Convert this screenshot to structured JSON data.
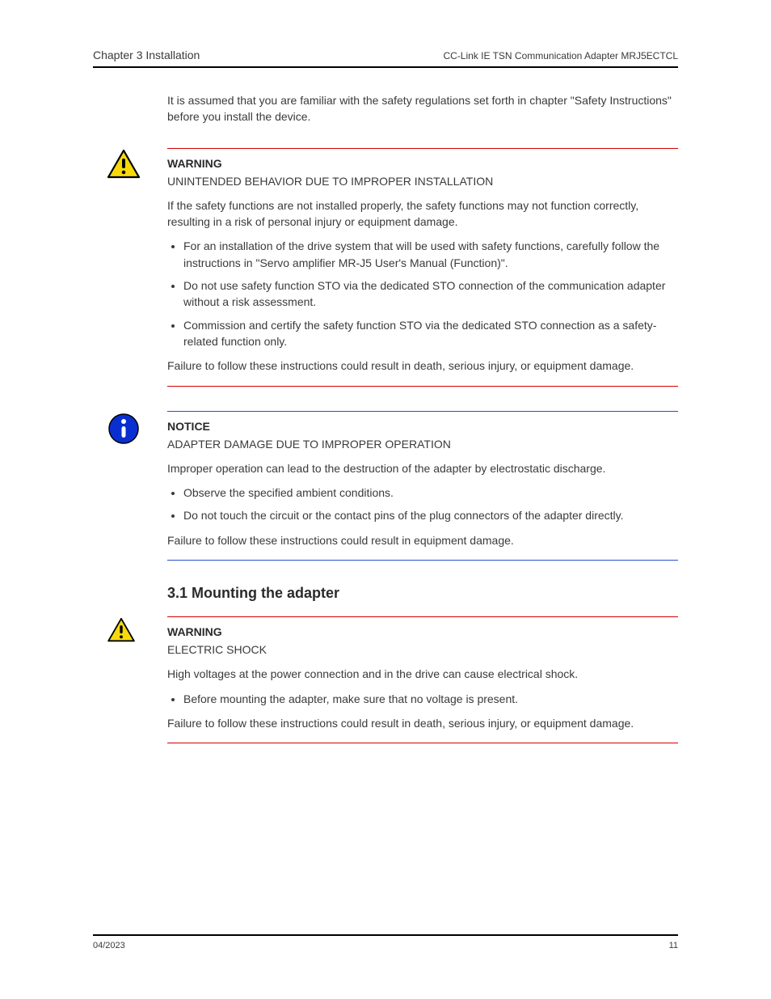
{
  "header": {
    "chapter": "Chapter 3 Installation",
    "doc": "CC-Link IE TSN Communication Adapter MRJ5ECTCL"
  },
  "intro": "It is assumed that you are familiar with the safety regulations set forth in chapter \"Safety Instructions\" before you install the device.",
  "block1": {
    "title": "WARNING",
    "p1": "UNINTENDED BEHAVIOR DUE TO IMPROPER INSTALLATION",
    "p2": "If the safety functions are not installed properly, the safety functions may not function correctly, resulting in a risk of personal injury or equipment damage.",
    "bullets": [
      "For an installation of the drive system that will be used with safety functions, carefully follow the instructions in \"Servo amplifier MR-J5 User's Manual (Function)\".",
      "Do not use safety function STO via the dedicated STO connection of the communication adapter without a risk assessment.",
      "Commission and certify the safety function STO via the dedicated STO connection as a safety-related function only."
    ],
    "p3": "Failure to follow these instructions could result in death, serious injury, or equipment damage."
  },
  "block2": {
    "title": "NOTICE",
    "p1": "ADAPTER DAMAGE DUE TO IMPROPER OPERATION",
    "p2": "Improper operation can lead to the destruction of the adapter by electrostatic discharge.",
    "bullets": [
      "Observe the specified ambient conditions.",
      "Do not touch the circuit or the contact pins of the plug connectors of the adapter directly."
    ],
    "p3": "Failure to follow these instructions could result in equipment damage."
  },
  "mounting": {
    "heading": "3.1 Mounting the adapter"
  },
  "block3": {
    "title": "WARNING",
    "p1": "ELECTRIC SHOCK",
    "p2": "High voltages at the power connection and in the drive can cause electrical shock.",
    "bullets": [
      "Before mounting the adapter, make sure that no voltage is present."
    ],
    "p3": "Failure to follow these instructions could result in death, serious injury, or equipment damage."
  },
  "footer": {
    "left": "04/2023",
    "right": "11"
  }
}
